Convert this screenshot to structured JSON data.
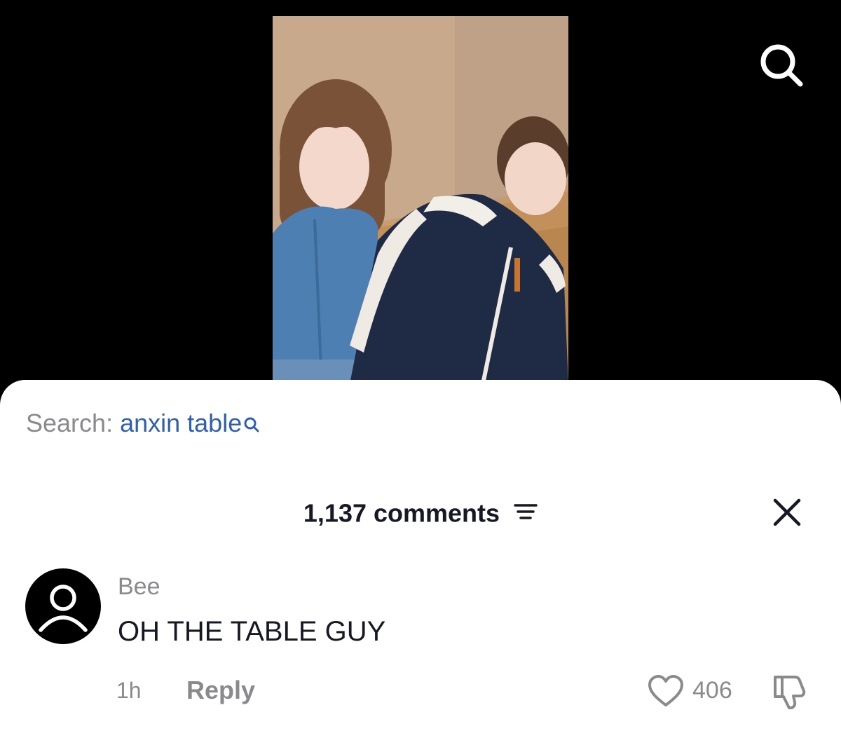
{
  "video": {
    "search_icon": "search-icon"
  },
  "search_suggestion": {
    "prefix": "Search:",
    "term": "anxin table",
    "icon": "search-icon"
  },
  "comments": {
    "count_label": "1,137 comments",
    "sort_icon": "sort-icon",
    "close_icon": "close-icon"
  },
  "comment": {
    "avatar_icon": "default-avatar-icon",
    "username": "Bee",
    "text": "OH THE TABLE GUY",
    "time": "1h",
    "reply_label": "Reply",
    "like_icon": "heart-icon",
    "like_count": "406",
    "dislike_icon": "thumbs-down-icon"
  },
  "colors": {
    "background": "#000000",
    "sheet": "#ffffff",
    "link_blue": "#2f5fae",
    "muted_gray": "#8a8a8e",
    "text_dark": "#161823"
  }
}
